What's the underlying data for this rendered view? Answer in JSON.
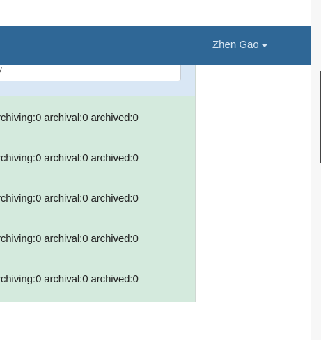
{
  "header": {
    "user_name": "Zhen Gao",
    "user_menu_icon": "caret-down-icon",
    "background_color": "#2f6796",
    "text_color": "#d8e6f3"
  },
  "search": {
    "value": "",
    "placeholder": ""
  },
  "panel": {
    "background_color": "#d4eadd",
    "search_band_color": "#d9e7f5",
    "rows": [
      {
        "text": "rchiving:0 archival:0 archived:0"
      },
      {
        "text": "rchiving:0 archival:0 archived:0"
      },
      {
        "text": "rchiving:0 archival:0 archived:0"
      },
      {
        "text": "rchiving:0 archival:0 archived:0"
      },
      {
        "text": "rchiving:0 archival:0 archived:0"
      }
    ]
  }
}
